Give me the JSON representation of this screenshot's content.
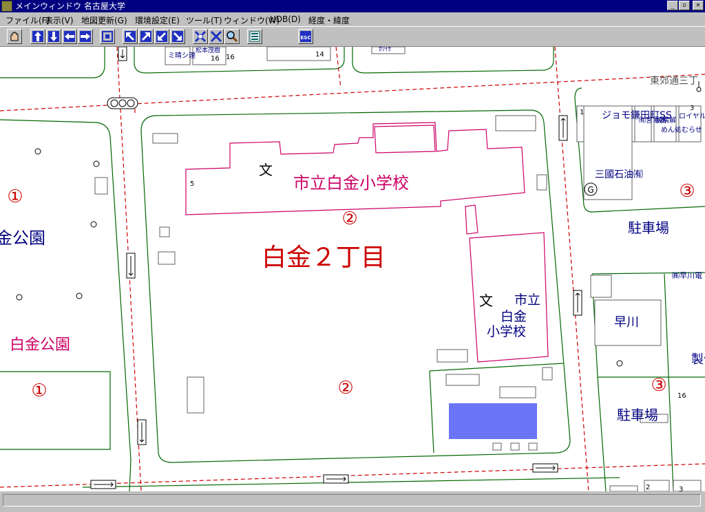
{
  "window": {
    "title": "メインウィンドウ 名古屋大学"
  },
  "menu": [
    "ファイル(F)",
    "表示(V)",
    "地図更新(G)",
    "環境設定(E)",
    "ツール(T)",
    "ウィンドウ(W)",
    "UDB(D)",
    "経度・緯度"
  ],
  "toolbar": {
    "icons": [
      "hand-icon",
      "arrow-up-icon",
      "arrow-down-icon",
      "arrow-left-icon",
      "arrow-right-icon",
      "fit-view-icon",
      "arrow-up-left-icon",
      "arrow-up-right-icon",
      "arrow-down-left-icon",
      "arrow-down-right-icon",
      "zoom-in-icon",
      "zoom-out-icon",
      "magnifier-icon",
      "layers-icon",
      "esc-icon"
    ],
    "esc_label": "ESC"
  },
  "map": {
    "district_label": "白金２丁目",
    "school_label": "市立白金小学校",
    "school_label_vertical": [
      "市立",
      "白金",
      "小学校"
    ],
    "school_symbol": "文",
    "park_partial": "金公園",
    "park_name": "白金公園",
    "parking_1": "駐車場",
    "parking_2": "駐車場",
    "road_name": "東郊通三丁",
    "building_hayakawa": "早川",
    "company_label": "㈱早川電",
    "factory_label": "製作所",
    "gas_station_label": "ジョモ鎌田町SS",
    "oil_label": "三國石油㈲",
    "shop_labels": [
      "㈲宮電器",
      "㈱精解",
      "めん処むらせ",
      "ロイヤル"
    ],
    "top_labels": [
      "ミ晴シ理",
      "松本茂樹",
      "ｶﾜｲｾ"
    ],
    "block_numbers": [
      "①",
      "①",
      "②",
      "②",
      "③",
      "③"
    ],
    "lot_numbers": [
      "5",
      "16",
      "16",
      "14",
      "1",
      "3",
      "16",
      "2",
      "3"
    ],
    "symbol_g": "G",
    "colors": {
      "road": "#cc0000",
      "boundary": "#006600",
      "building": "#cc0066",
      "label": "#000080",
      "highlight": "#6a75f5"
    }
  },
  "statusbar": {
    "text": ""
  }
}
